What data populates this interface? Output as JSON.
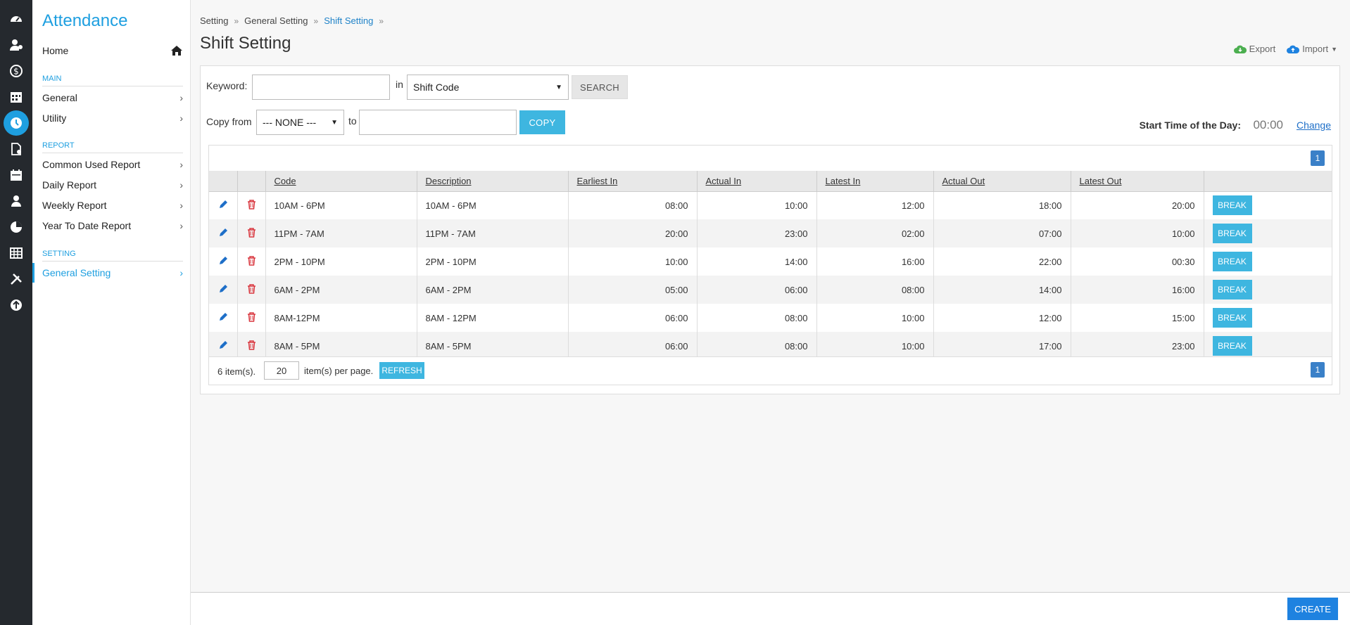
{
  "rail": {
    "icons": [
      "dashboard-icon",
      "user-settings-icon",
      "payroll-icon",
      "calendar-grid-icon",
      "clock-icon",
      "document-icon",
      "calendar-icon",
      "person-icon",
      "pie-chart-icon",
      "table-icon",
      "tools-icon",
      "upload-icon"
    ]
  },
  "sidebar": {
    "title": "Attendance",
    "home": "Home",
    "sections": {
      "main": "MAIN",
      "report": "REPORT",
      "setting": "SETTING"
    },
    "main_items": [
      "General",
      "Utility"
    ],
    "report_items": [
      "Common Used Report",
      "Daily Report",
      "Weekly Report",
      "Year To Date Report"
    ],
    "setting_items": [
      "General Setting"
    ]
  },
  "breadcrumb": {
    "items": [
      "Setting",
      "General Setting",
      "Shift Setting"
    ],
    "sep": "»"
  },
  "page": {
    "title": "Shift Setting",
    "export": "Export",
    "import": "Import"
  },
  "search": {
    "keyword_label": "Keyword:",
    "keyword_value": "",
    "in_label": "in",
    "field_selected": "Shift Code",
    "search_btn": "SEARCH"
  },
  "copy": {
    "from_label": "Copy from",
    "from_selected": "--- NONE ---",
    "to_label": "to",
    "to_value": "",
    "copy_btn": "COPY"
  },
  "start_time": {
    "label": "Start Time of the Day:",
    "value": "00:00",
    "change": "Change"
  },
  "table": {
    "page": "1",
    "columns": [
      "Code",
      "Description",
      "Earliest In",
      "Actual In",
      "Latest In",
      "Actual Out",
      "Latest Out"
    ],
    "break_label": "BREAK",
    "rows": [
      {
        "code": "10AM - 6PM",
        "desc": "10AM - 6PM",
        "earliest_in": "08:00",
        "actual_in": "10:00",
        "latest_in": "12:00",
        "actual_out": "18:00",
        "latest_out": "20:00"
      },
      {
        "code": "11PM - 7AM",
        "desc": "11PM - 7AM",
        "earliest_in": "20:00",
        "actual_in": "23:00",
        "latest_in": "02:00",
        "actual_out": "07:00",
        "latest_out": "10:00"
      },
      {
        "code": "2PM - 10PM",
        "desc": "2PM - 10PM",
        "earliest_in": "10:00",
        "actual_in": "14:00",
        "latest_in": "16:00",
        "actual_out": "22:00",
        "latest_out": "00:30"
      },
      {
        "code": "6AM - 2PM",
        "desc": "6AM - 2PM",
        "earliest_in": "05:00",
        "actual_in": "06:00",
        "latest_in": "08:00",
        "actual_out": "14:00",
        "latest_out": "16:00"
      },
      {
        "code": "8AM-12PM",
        "desc": "8AM - 12PM",
        "earliest_in": "06:00",
        "actual_in": "08:00",
        "latest_in": "10:00",
        "actual_out": "12:00",
        "latest_out": "15:00"
      },
      {
        "code": "8AM - 5PM",
        "desc": "8AM - 5PM",
        "earliest_in": "06:00",
        "actual_in": "08:00",
        "latest_in": "10:00",
        "actual_out": "17:00",
        "latest_out": "23:00"
      }
    ],
    "footer": {
      "count": "6 item(s).",
      "per_page_value": "20",
      "per_page_label": "item(s) per page.",
      "refresh": "REFRESH"
    }
  },
  "actions": {
    "create": "CREATE"
  },
  "colors": {
    "accent": "#1e9fe0",
    "rail": "#25292e",
    "button_blue": "#3eb6e0",
    "delete_red": "#d9363e",
    "edit_blue": "#1e6fc8"
  }
}
